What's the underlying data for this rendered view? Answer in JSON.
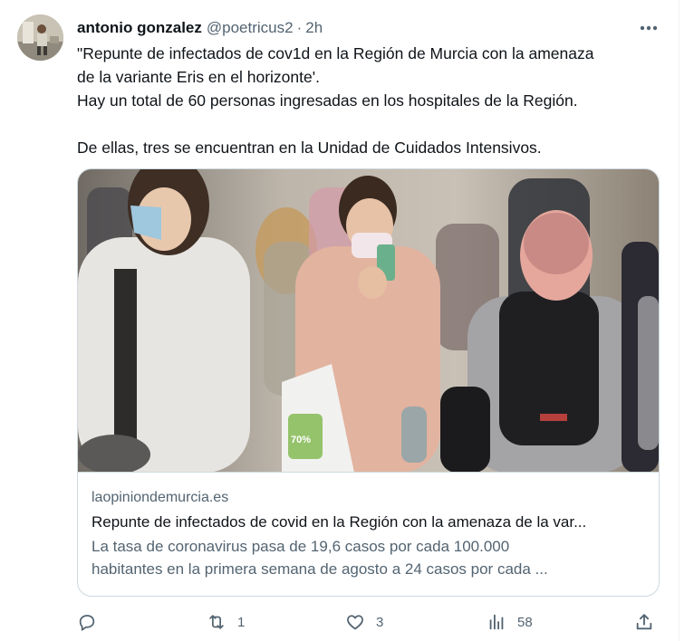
{
  "tweet": {
    "author_name": "antonio gonzalez",
    "author_handle": "@poetricus2",
    "separator": "·",
    "time": "2h",
    "text_lines": [
      "\"Repunte de infectados de cov1d en la Región de Murcia con la amenaza",
      "de la variante Eris en el horizonte'.",
      "Hay un total de 60 personas ingresadas en los hospitales de la Región.",
      "De ellas, tres se encuentran en la Unidad de Cuidados Intensivos."
    ]
  },
  "card": {
    "domain": "laopiniondemurcia.es",
    "title": "Repunte de infectados de covid en la Región con la amenaza de la var...",
    "description_lines": [
      "La tasa de coronavirus pasa de 19,6 casos por cada 100.000",
      "habitantes en la primera semana de agosto a 24 casos por cada ..."
    ],
    "image_bag_text": "70%"
  },
  "actions": {
    "reply_count": "",
    "retweet_count": "1",
    "like_count": "3",
    "views_count": "58"
  },
  "icons": {
    "more": "more-horizontal-icon",
    "reply": "reply-icon",
    "retweet": "retweet-icon",
    "like": "heart-icon",
    "views": "views-chart-icon",
    "share": "share-icon"
  },
  "colors": {
    "text_primary": "#0f1419",
    "text_secondary": "#536471",
    "border": "#cfd9de",
    "background": "#ffffff"
  }
}
